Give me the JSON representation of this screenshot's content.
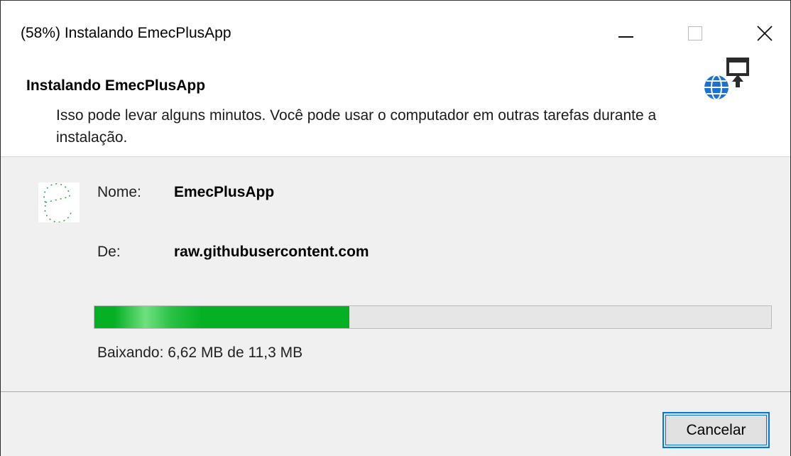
{
  "window": {
    "title": "(58%) Instalando EmecPlusApp"
  },
  "header": {
    "title": "Instalando EmecPlusApp",
    "subtitle": "Isso pode levar alguns minutos. Você pode usar o computador em outras tarefas durante a instalação.",
    "icon": "globe-install-icon"
  },
  "app": {
    "icon": "app-e-icon",
    "name_label": "Nome:",
    "name_value": "EmecPlusApp",
    "from_label": "De:",
    "from_value": "raw.githubusercontent.com"
  },
  "progress": {
    "fraction": 0.377,
    "status": "Baixando: 6,62 MB de 11,3 MB",
    "color": "#06b025"
  },
  "footer": {
    "cancel_label": "Cancelar"
  },
  "colors": {
    "accent": "#0078d7",
    "content_bg": "#f0f0f0"
  }
}
